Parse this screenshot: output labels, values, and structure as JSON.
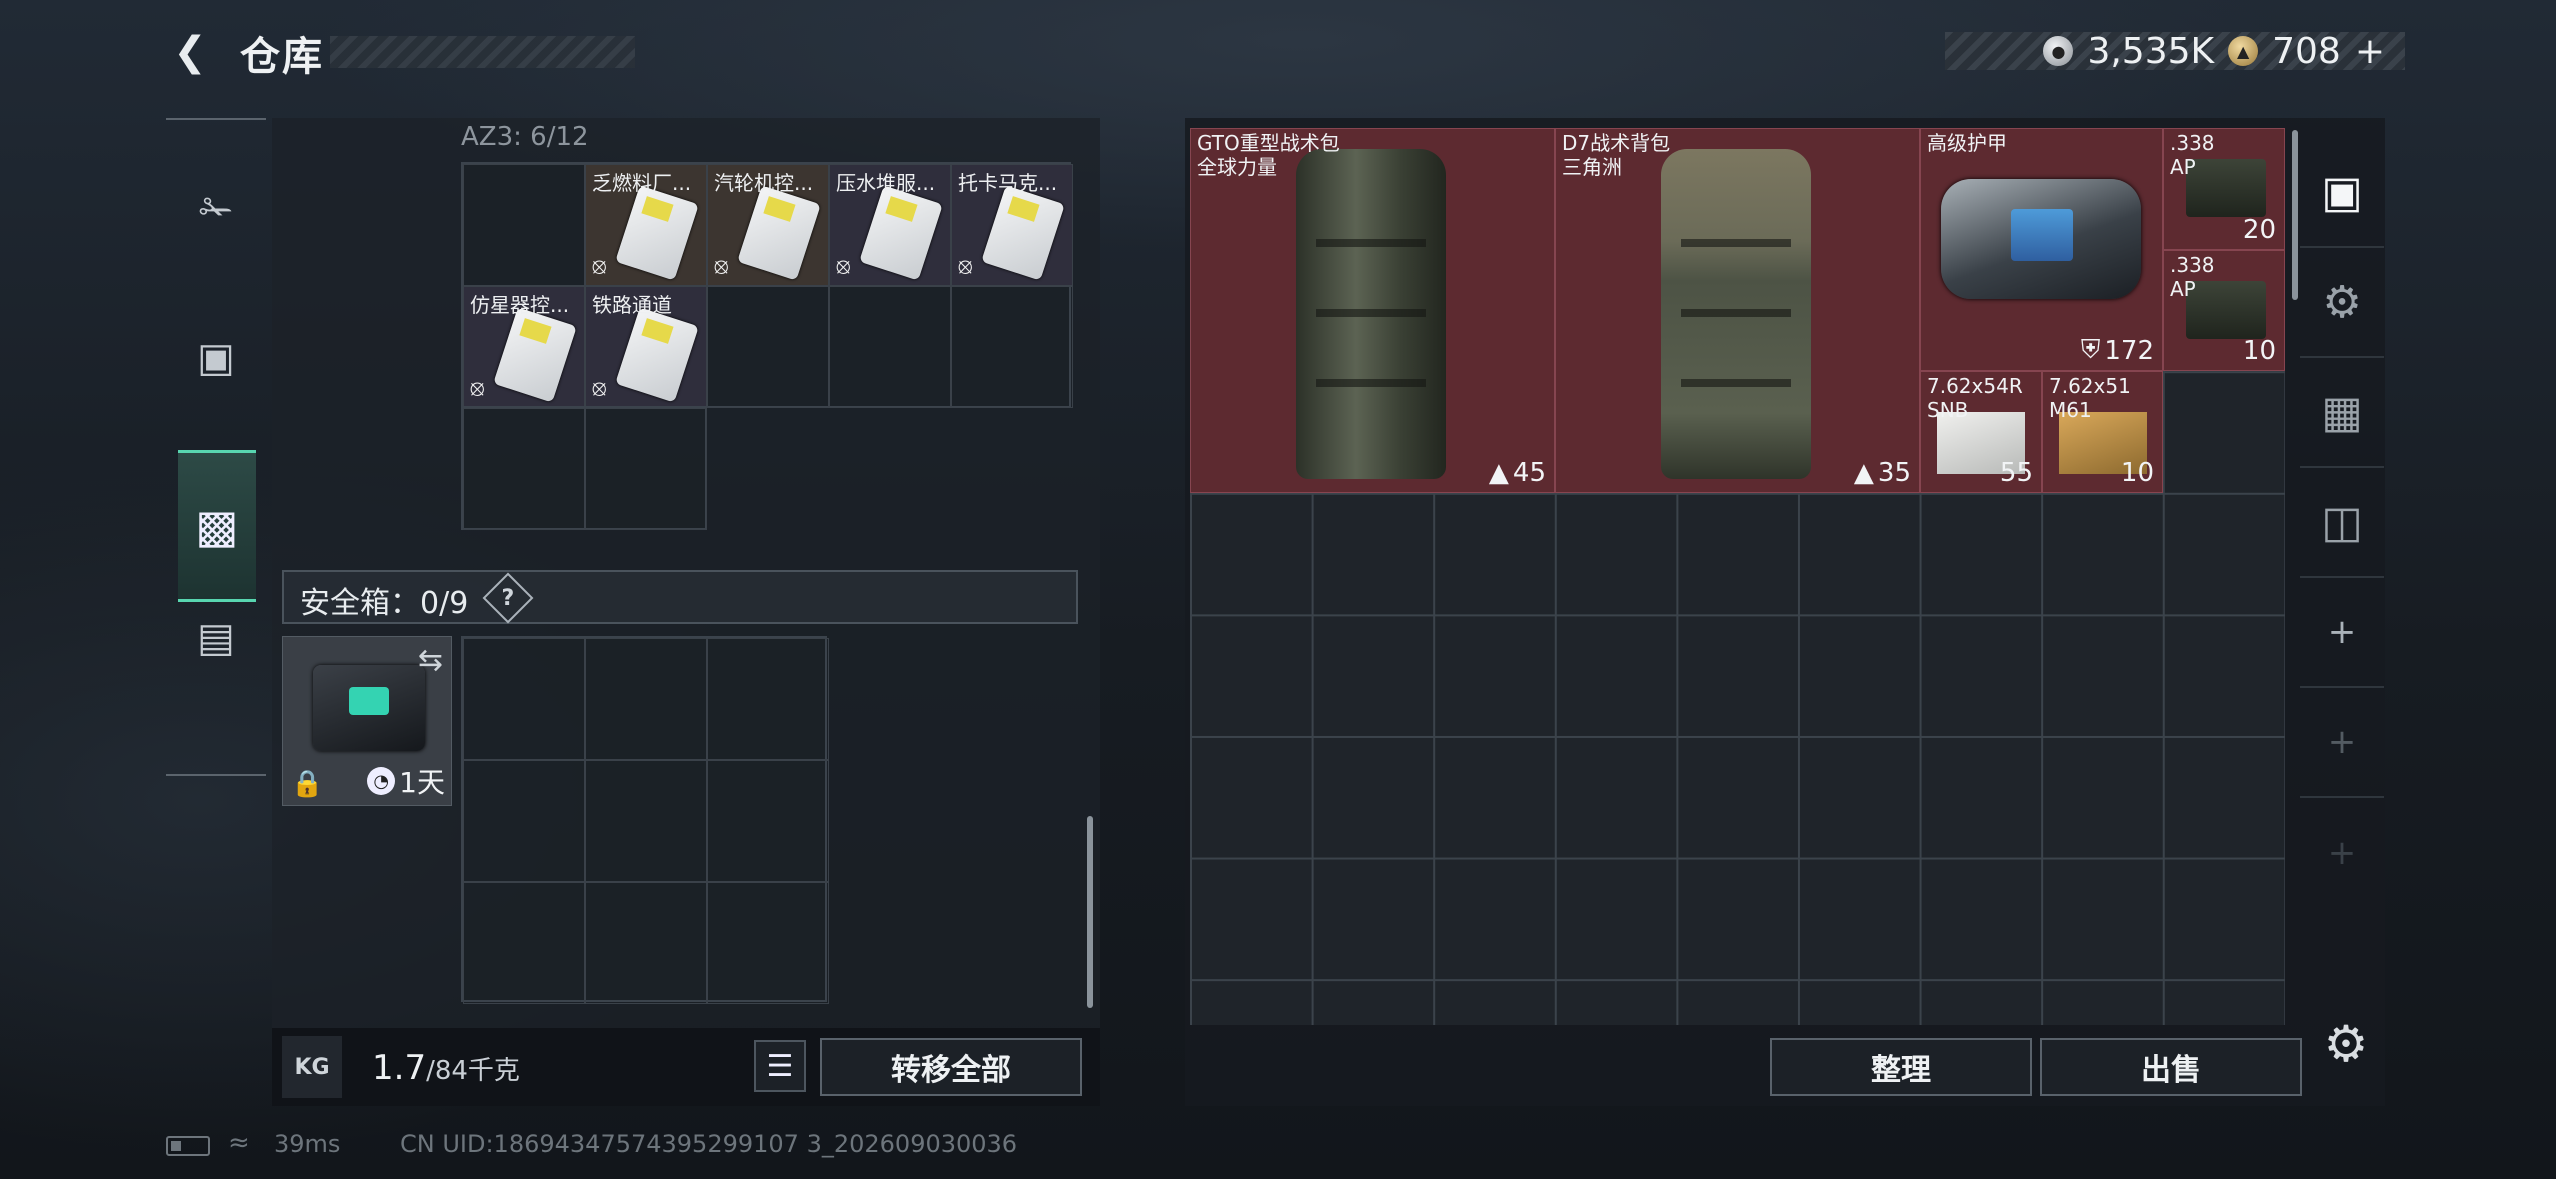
{
  "header": {
    "title": "仓库",
    "back_icon": "back-arrow-icon"
  },
  "currency": {
    "silver_value": "3,535K",
    "gold_value": "708",
    "add_label": "+"
  },
  "left_sidebar": {
    "items": [
      "pistol-icon",
      "chest-rig-icon",
      "backpack-icon",
      "briefcase-icon"
    ],
    "active": "backpack-icon"
  },
  "container": {
    "label": "AZ3: 6/12",
    "items": [
      {
        "name": "乏燃料厂...",
        "color": "brown"
      },
      {
        "name": "汽轮机控...",
        "color": "brown"
      },
      {
        "name": "压水堆服...",
        "color": "purple"
      },
      {
        "name": "托卡马克...",
        "color": "purple"
      },
      {
        "name": "仿星器控...",
        "color": "purple"
      },
      {
        "name": "铁路通道",
        "color": "purple"
      }
    ]
  },
  "safebox": {
    "label": "安全箱：0/9",
    "help": "?",
    "timer": "1天"
  },
  "weight": {
    "current": "1.7",
    "max": "/84千克",
    "icon_label": "KG"
  },
  "buttons": {
    "transfer_all": "转移全部",
    "sort": "整理",
    "sell": "出售"
  },
  "stash_items": [
    {
      "name": "GTO重型战术包",
      "sub": "全球力量",
      "count": "45"
    },
    {
      "name": "D7战术背包",
      "sub": "三角洲",
      "count": "35"
    },
    {
      "name": "高级护甲",
      "sub": "",
      "count": "172"
    },
    {
      "name": ".338",
      "sub": "AP",
      "count": "20"
    },
    {
      "name": ".338",
      "sub": "AP",
      "count": "10"
    },
    {
      "name": "7.62x54R",
      "sub": "SNB",
      "count": "55"
    },
    {
      "name": "7.62x51",
      "sub": "M61",
      "count": "10"
    }
  ],
  "right_sidebar": {
    "items": [
      "vault-icon",
      "weapon-rack-icon",
      "armor-rack-icon",
      "gun-display-icon",
      "plus-icon",
      "plus-icon-dim",
      "plus-icon-dimmer"
    ]
  },
  "status": {
    "ping": "39ms",
    "uid": "CN UID:18694347574395299107 3_202609030036"
  },
  "colors": {
    "accent": "#58d6b0",
    "rare_red": "#5d2a30",
    "brown_item": "#3c3530",
    "purple_item": "#2f2e3c"
  }
}
